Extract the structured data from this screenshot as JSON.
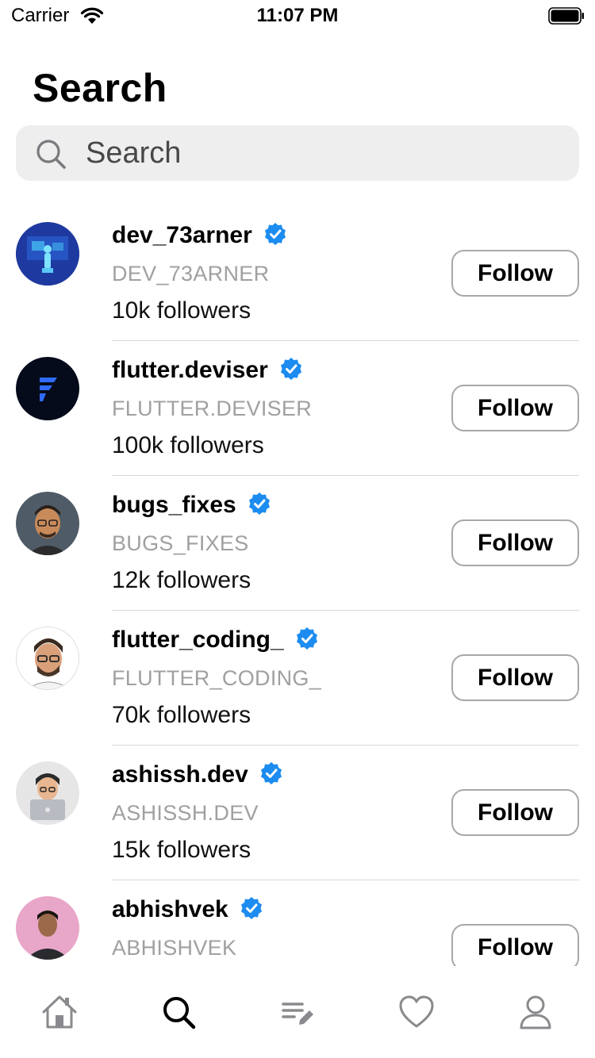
{
  "status_bar": {
    "carrier": "Carrier",
    "time": "11:07 PM"
  },
  "title": "Search",
  "search": {
    "placeholder": "Search",
    "value": ""
  },
  "colors": {
    "verified": "#1d8cf0",
    "handle": "#a0a0a0",
    "search_bg": "#eeeeef"
  },
  "users": [
    {
      "username": "dev_73arner",
      "handle": "DEV_73ARNER",
      "followers": "10k followers",
      "button": "Follow",
      "avatar": "hologram-avatar"
    },
    {
      "username": "flutter.deviser",
      "handle": "FLUTTER.DEVISER",
      "followers": "100k followers",
      "button": "Follow",
      "avatar": "flutter-logo-avatar"
    },
    {
      "username": "bugs_fixes",
      "handle": "BUGS_FIXES",
      "followers": "12k followers",
      "button": "Follow",
      "avatar": "memoji-glasses-avatar"
    },
    {
      "username": "flutter_coding_",
      "handle": "FLUTTER_CODING_",
      "followers": "70k followers",
      "button": "Follow",
      "avatar": "cartoon-man-avatar"
    },
    {
      "username": "ashissh.dev",
      "handle": "ASHISSH.DEV",
      "followers": "15k followers",
      "button": "Follow",
      "avatar": "laptop-boy-avatar"
    },
    {
      "username": "abhishvek",
      "handle": "ABHISHVEK",
      "followers": "",
      "button": "Follow",
      "avatar": "photo-avatar"
    }
  ],
  "tabs": [
    {
      "icon": "home-icon"
    },
    {
      "icon": "search-icon",
      "active": true
    },
    {
      "icon": "edit-list-icon"
    },
    {
      "icon": "heart-icon"
    },
    {
      "icon": "profile-icon"
    }
  ]
}
